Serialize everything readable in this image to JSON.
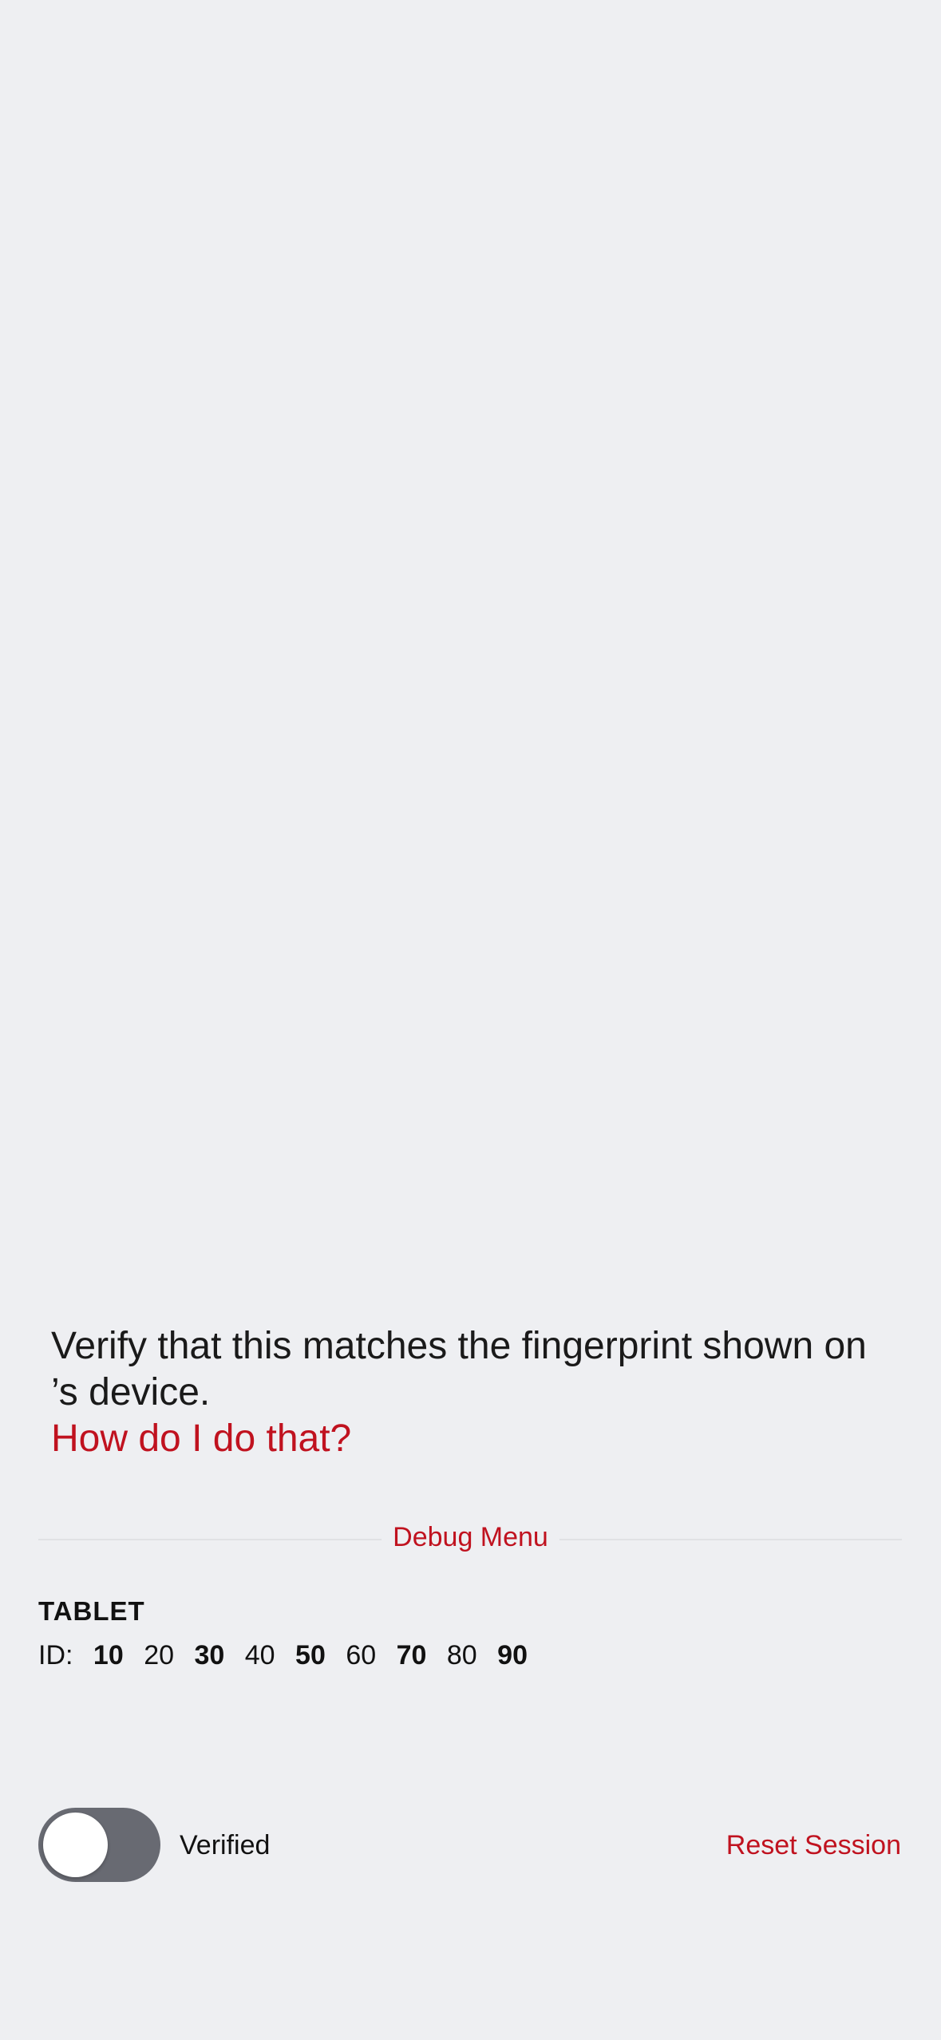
{
  "verification": {
    "instruction_line1": "Verify that this matches the fingerprint shown on",
    "instruction_line2": "’s device.",
    "help_link": "How do I do that?"
  },
  "debug": {
    "menu_label": "Debug Menu"
  },
  "device": {
    "name": "TABLET",
    "id_prefix": "ID:",
    "id_groups": [
      "10",
      "20",
      "30",
      "40",
      "50",
      "60",
      "70",
      "80",
      "90"
    ]
  },
  "footer": {
    "toggle_label": "Verified",
    "toggle_on": false,
    "reset_label": "Reset Session"
  },
  "colors": {
    "background": "#eeeff2",
    "accent": "#c0121f",
    "toggle_off": "#686a72"
  }
}
